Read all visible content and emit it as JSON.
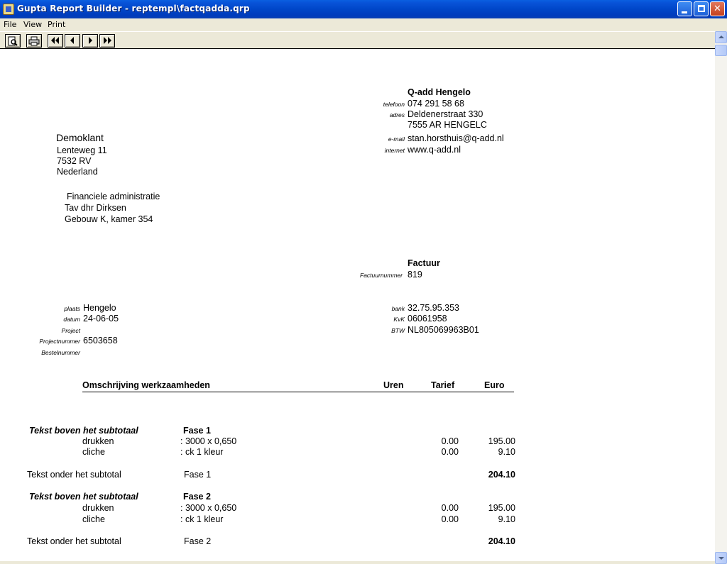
{
  "window": {
    "title": "Gupta Report Builder - reptempl\\factqadda.qrp"
  },
  "menu": [
    "File",
    "View",
    "Print"
  ],
  "toolbar": {
    "preview_icon": "preview-icon",
    "print_icon": "printer-icon",
    "nav_icons": [
      "first-page-icon",
      "previous-page-icon",
      "next-page-icon",
      "last-page-icon"
    ]
  },
  "company": {
    "name": "Q-add Hengelo",
    "telefoon_label": "telefoon",
    "telefoon": "074 291 58 68",
    "adres_label": "adres",
    "adres1": "Deldenerstraat 330",
    "adres2": "7555 AR HENGELC",
    "email_label": "e-mail",
    "email": "stan.horsthuis@q-add.nl",
    "internet_label": "internet",
    "internet": "www.q-add.nl"
  },
  "client": {
    "name": "Demoklant",
    "street": "Lenteweg 11",
    "postcode": "7532 RV",
    "country": "Nederland",
    "dept": "Financiele administratie",
    "attn": "Tav dhr Dirksen",
    "building": "Gebouw K, kamer 354"
  },
  "invoice": {
    "heading": "Factuur",
    "number_label": "Factuurnummer",
    "number": "819"
  },
  "details_left": {
    "plaats_label": "plaats",
    "plaats": "Hengelo",
    "datum_label": "datum",
    "datum": "24-06-05",
    "project_label": "Project",
    "projectnummer_label": "Projectnummer",
    "projectnummer": "6503658",
    "bestelnummer_label": "Bestelnummer"
  },
  "details_right": {
    "bank_label": "bank",
    "bank": "32.75.95.353",
    "kvk_label": "KvK",
    "kvk": "06061958",
    "btw_label": "BTW",
    "btw": "NL805069963B01"
  },
  "table_header": {
    "description": "Omschrijving werkzaamheden",
    "hours": "Uren",
    "rate": "Tarief",
    "amount": "Euro"
  },
  "groups": [
    {
      "above_label": "Tekst boven het subtotaal",
      "phase": "Fase 1",
      "lines": [
        {
          "item": "drukken",
          "detail": ": 3000 x 0,650",
          "rate": "0.00",
          "amount": "195.00"
        },
        {
          "item": "cliche",
          "detail": ": ck 1 kleur",
          "rate": "0.00",
          "amount": "9.10"
        }
      ],
      "below_label": "Tekst onder het subtotal",
      "below_phase": "Fase 1",
      "subtotal": "204.10"
    },
    {
      "above_label": "Tekst boven het subtotaal",
      "phase": "Fase 2",
      "lines": [
        {
          "item": "drukken",
          "detail": ": 3000 x 0,650",
          "rate": "0.00",
          "amount": "195.00"
        },
        {
          "item": "cliche",
          "detail": ": ck 1 kleur",
          "rate": "0.00",
          "amount": "9.10"
        }
      ],
      "below_label": "Tekst onder het subtotal",
      "below_phase": "Fase 2",
      "subtotal": "204.10"
    }
  ]
}
